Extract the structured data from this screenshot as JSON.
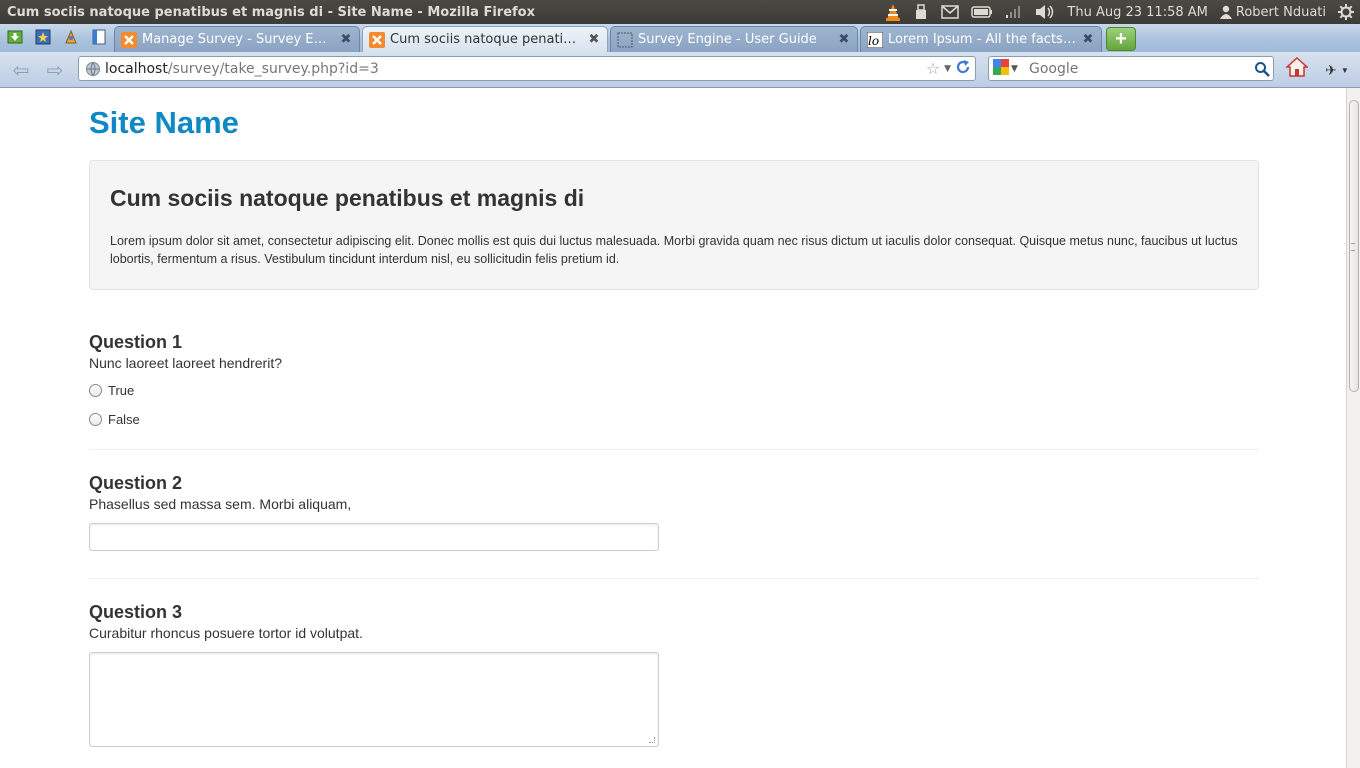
{
  "os_panel": {
    "window_title": "Cum sociis natoque penatibus et magnis di - Site Name - Mozilla Firefox",
    "datetime": "Thu Aug 23 11:58 AM",
    "user": "Robert Nduati",
    "tray_icons": [
      "vlc-icon",
      "usb-icon",
      "mail-icon",
      "battery-icon",
      "network-icon",
      "volume-icon",
      "user-icon",
      "power-gear-icon"
    ]
  },
  "tabs": [
    {
      "label": "Manage Survey - Survey Engine",
      "favicon": "survey-icon",
      "active": false
    },
    {
      "label": "Cum sociis natoque penatib…",
      "favicon": "survey-icon",
      "active": true
    },
    {
      "label": "Survey Engine - User Guide",
      "favicon": "blank-page-icon",
      "active": false
    },
    {
      "label": "Lorem Ipsum - All the facts -…",
      "favicon": "lorem-ipsum-icon",
      "active": false
    }
  ],
  "app_tab_icons": [
    "download-icon",
    "bookmark-star-icon",
    "extension-icon",
    "document-icon"
  ],
  "navbar": {
    "url_host": "localhost",
    "url_path": "/survey/take_survey.php?id=3",
    "search_placeholder": "Google"
  },
  "page": {
    "site_name": "Site Name",
    "survey_title": "Cum sociis natoque penatibus et magnis di",
    "survey_description": "Lorem ipsum dolor sit amet, consectetur adipiscing elit. Donec mollis est quis dui luctus malesuada. Morbi gravida quam nec risus dictum ut iaculis dolor consequat. Quisque metus nunc, faucibus ut luctus lobortis, fermentum a risus. Vestibulum tincidunt interdum nisl, eu sollicitudin felis pretium id.",
    "questions": [
      {
        "heading": "Question 1",
        "text": "Nunc laoreet laoreet hendrerit?",
        "type": "radio",
        "options": [
          "True",
          "False"
        ]
      },
      {
        "heading": "Question 2",
        "text": "Phasellus sed massa sem. Morbi aliquam,",
        "type": "text"
      },
      {
        "heading": "Question 3",
        "text": "Curabitur rhoncus posuere tortor id volutpat.",
        "type": "textarea"
      }
    ]
  },
  "colors": {
    "site_name": "#0f88c6",
    "panel_bg": "#3c3b37",
    "hero_bg": "#f5f5f5"
  }
}
